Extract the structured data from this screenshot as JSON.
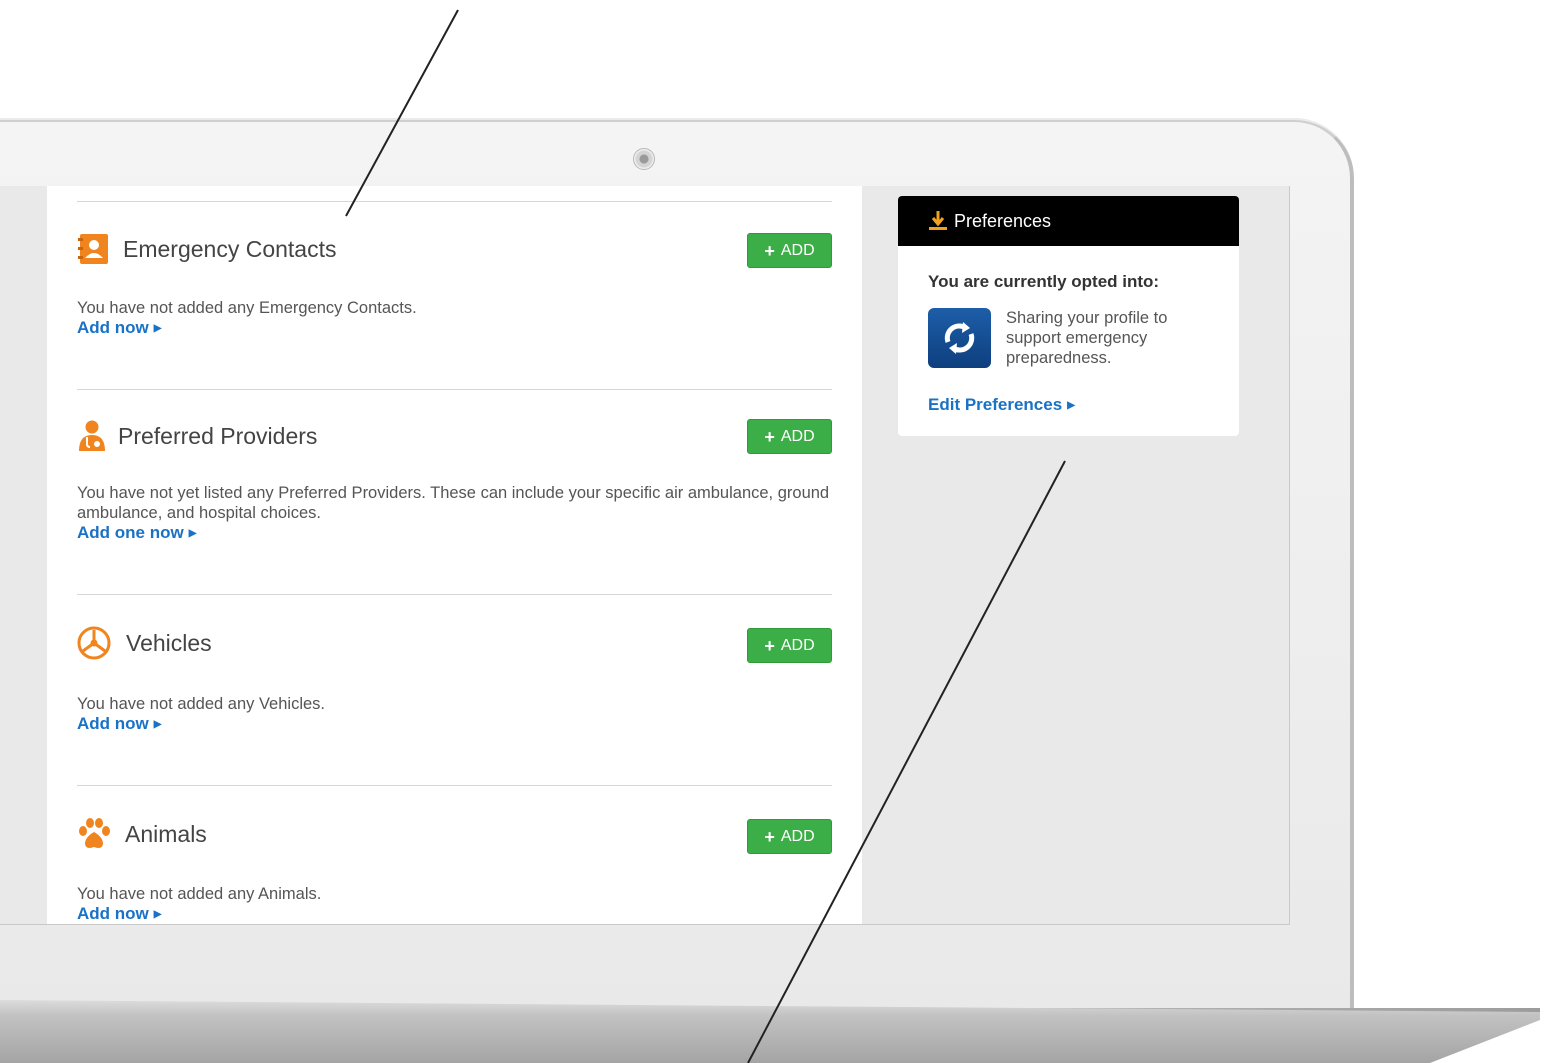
{
  "sections": [
    {
      "title": "Emergency Contacts",
      "icon": "contacts-book-icon",
      "add_label": "ADD",
      "description": "You have not added any Emergency Contacts.",
      "link": "Add now"
    },
    {
      "title": "Preferred Providers",
      "icon": "doctor-icon",
      "add_label": "ADD",
      "description": "You have not yet listed any Preferred Providers. These can include your specific air ambulance, ground ambulance, and hospital choices.",
      "link": "Add one now"
    },
    {
      "title": "Vehicles",
      "icon": "steering-wheel-icon",
      "add_label": "ADD",
      "description": "You have not added any Vehicles.",
      "link": "Add now"
    },
    {
      "title": "Animals",
      "icon": "paw-print-icon",
      "add_label": "ADD",
      "description": "You have not added any Animals.",
      "link": "Add now"
    }
  ],
  "preferences": {
    "header": "Preferences",
    "header_icon": "download-icon",
    "opted_label": "You are currently opted into:",
    "item_icon": "sync-icon",
    "item_text": "Sharing your profile to support emergency preparedness.",
    "edit_link": "Edit Preferences"
  },
  "colors": {
    "add_button": "#3cae48",
    "link": "#1a72c6",
    "icon_orange": "#f0851f",
    "header_bg": "#000000",
    "sync_icon_bg": "#134c92"
  }
}
